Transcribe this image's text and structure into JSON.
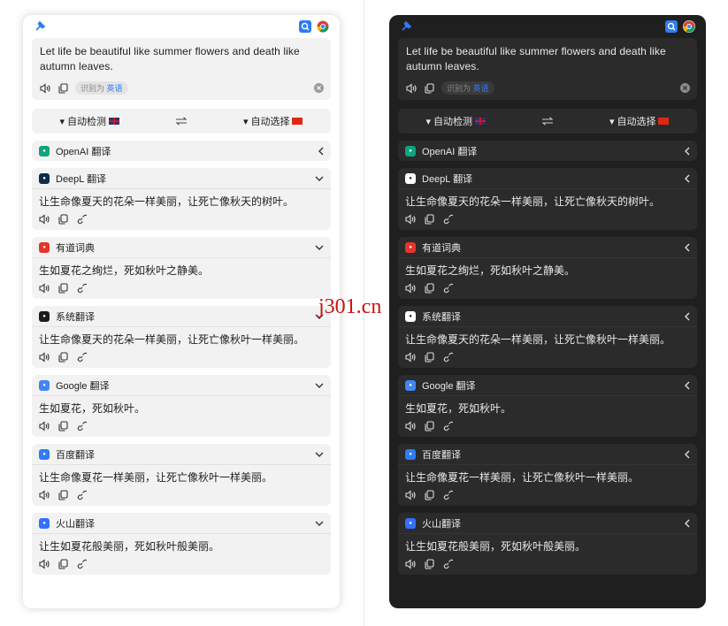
{
  "colors": {
    "accent": "#2f7bf4",
    "light_card": "#f2f2f2",
    "dark_bg": "#1f1f1f",
    "dark_card": "#2b2b2b"
  },
  "panels": [
    {
      "theme": "light",
      "source": {
        "text": "Let life be beautiful like summer flowers and death like autumn leaves.",
        "detect_prefix": "识别为",
        "detect_lang": "英语"
      },
      "lang": {
        "from": "自动检测",
        "to": "自动选择",
        "from_flag": "uk-flag",
        "to_flag": "cn-flag"
      },
      "services": [
        {
          "name": "OpenAI 翻译",
          "icon": "openai-icon",
          "color": "#10a37f",
          "expanded": false,
          "chevron": "chevron-left-icon",
          "text": ""
        },
        {
          "name": "DeepL 翻译",
          "icon": "deepl-icon",
          "color": "#0f2b46",
          "expanded": true,
          "chevron": "chevron-down-icon",
          "text": "让生命像夏天的花朵一样美丽，让死亡像秋天的树叶。"
        },
        {
          "name": "有道词典",
          "icon": "youdao-icon",
          "color": "#e8332a",
          "expanded": true,
          "chevron": "chevron-down-icon",
          "text": "生如夏花之绚烂，死如秋叶之静美。"
        },
        {
          "name": "系统翻译",
          "icon": "system-translate-icon",
          "color": "#1c1c1c",
          "expanded": true,
          "chevron": "chevron-down-icon",
          "text": "让生命像夏天的花朵一样美丽，让死亡像秋叶一样美丽。"
        },
        {
          "name": "Google 翻译",
          "icon": "google-translate-icon",
          "color": "#4285f4",
          "expanded": true,
          "chevron": "chevron-down-icon",
          "text": "生如夏花，死如秋叶。"
        },
        {
          "name": "百度翻译",
          "icon": "baidu-icon",
          "color": "#2f7bf4",
          "expanded": true,
          "chevron": "chevron-down-icon",
          "text": "让生命像夏花一样美丽，让死亡像秋叶一样美丽。"
        },
        {
          "name": "火山翻译",
          "icon": "volcano-icon",
          "color": "#3370ff",
          "expanded": true,
          "chevron": "chevron-down-icon",
          "text": "让生如夏花般美丽，死如秋叶般美丽。"
        }
      ]
    },
    {
      "theme": "dark",
      "source": {
        "text": "Let life be beautiful like summer flowers and death like autumn leaves.",
        "detect_prefix": "识别为",
        "detect_lang": "英语"
      },
      "lang": {
        "from": "自动检测",
        "to": "自动选择",
        "from_flag": "uk-flag",
        "to_flag": "cn-flag"
      },
      "services": [
        {
          "name": "OpenAI 翻译",
          "icon": "openai-icon",
          "color": "#10a37f",
          "expanded": false,
          "chevron": "chevron-left-icon",
          "text": ""
        },
        {
          "name": "DeepL 翻译",
          "icon": "deepl-icon",
          "color": "#ffffff",
          "expanded": true,
          "chevron": "chevron-left-icon",
          "text": "让生命像夏天的花朵一样美丽，让死亡像秋天的树叶。"
        },
        {
          "name": "有道词典",
          "icon": "youdao-icon",
          "color": "#e8332a",
          "expanded": true,
          "chevron": "chevron-left-icon",
          "text": "生如夏花之绚烂，死如秋叶之静美。"
        },
        {
          "name": "系统翻译",
          "icon": "system-translate-icon",
          "color": "#ffffff",
          "expanded": true,
          "chevron": "chevron-left-icon",
          "text": "让生命像夏天的花朵一样美丽，让死亡像秋叶一样美丽。"
        },
        {
          "name": "Google 翻译",
          "icon": "google-translate-icon",
          "color": "#4285f4",
          "expanded": true,
          "chevron": "chevron-left-icon",
          "text": "生如夏花，死如秋叶。"
        },
        {
          "name": "百度翻译",
          "icon": "baidu-icon",
          "color": "#2f7bf4",
          "expanded": true,
          "chevron": "chevron-left-icon",
          "text": "让生命像夏花一样美丽，让死亡像秋叶一样美丽。"
        },
        {
          "name": "火山翻译",
          "icon": "volcano-icon",
          "color": "#3370ff",
          "expanded": true,
          "chevron": "chevron-left-icon",
          "text": "让生如夏花般美丽，死如秋叶般美丽。"
        }
      ]
    }
  ],
  "watermark": "j301.cn"
}
